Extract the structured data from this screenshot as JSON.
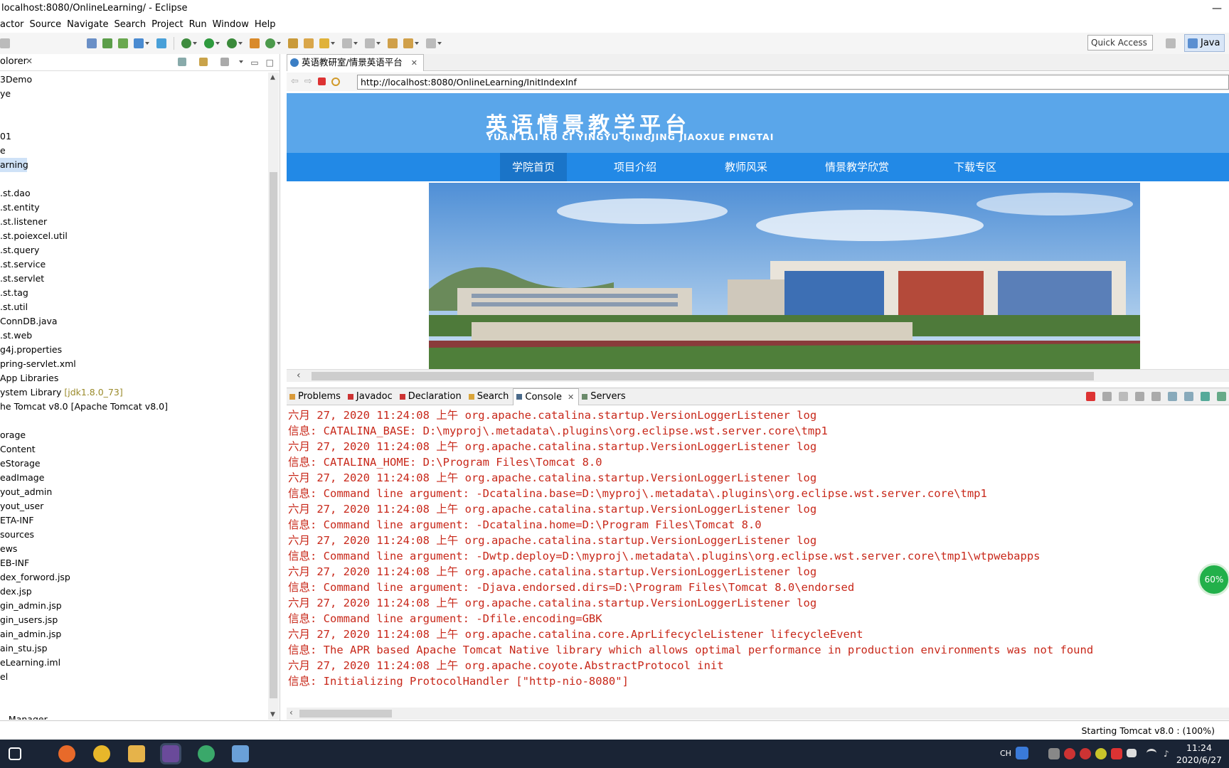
{
  "window": {
    "title": "localhost:8080/OnlineLearning/ - Eclipse"
  },
  "menu": [
    "actor",
    "Source",
    "Navigate",
    "Search",
    "Project",
    "Run",
    "Window",
    "Help"
  ],
  "toolbar": {
    "quick_access": "Quick Access",
    "perspective": "Java"
  },
  "explorer": {
    "tab_label": "olorer",
    "rows": [
      {
        "text": "3Demo"
      },
      {
        "text": "ye"
      },
      {
        "text": ""
      },
      {
        "text": ""
      },
      {
        "text": "01"
      },
      {
        "text": "e"
      },
      {
        "text": "arning",
        "selected": true
      },
      {
        "text": ""
      },
      {
        "text": ".st.dao"
      },
      {
        "text": ".st.entity"
      },
      {
        "text": ".st.listener"
      },
      {
        "text": ".st.poiexcel.util"
      },
      {
        "text": ".st.query"
      },
      {
        "text": ".st.service"
      },
      {
        "text": ".st.servlet"
      },
      {
        "text": ".st.tag"
      },
      {
        "text": ".st.util"
      },
      {
        "text": " ConnDB.java"
      },
      {
        "text": ".st.web"
      },
      {
        "text": "g4j.properties"
      },
      {
        "text": "pring-servlet.xml"
      },
      {
        "text": " App Libraries"
      },
      {
        "text": "ystem Library ",
        "suffix": "[jdk1.8.0_73]"
      },
      {
        "text": "he Tomcat v8.0 [Apache Tomcat v8.0]"
      },
      {
        "text": ""
      },
      {
        "text": "orage"
      },
      {
        "text": "Content"
      },
      {
        "text": "eStorage"
      },
      {
        "text": "eadImage"
      },
      {
        "text": "yout_admin"
      },
      {
        "text": "yout_user"
      },
      {
        "text": "ETA-INF"
      },
      {
        "text": "sources"
      },
      {
        "text": "ews"
      },
      {
        "text": "EB-INF"
      },
      {
        "text": "dex_forword.jsp"
      },
      {
        "text": "dex.jsp"
      },
      {
        "text": "gin_admin.jsp"
      },
      {
        "text": "gin_users.jsp"
      },
      {
        "text": "ain_admin.jsp"
      },
      {
        "text": "ain_stu.jsp"
      },
      {
        "text": "eLearning.iml"
      },
      {
        "text": "el"
      },
      {
        "text": ""
      },
      {
        "text": ""
      },
      {
        "text": "...Manager"
      }
    ]
  },
  "editor": {
    "tab_label": "英语教研室/情景英语平台",
    "url": "http://localhost:8080/OnlineLearning/InitIndexInf",
    "site": {
      "title": "英语情景教学平台",
      "subtitle": "YUAN  LAI  RU CI  YINGYU  QINGJING  JIAOXUE PINGTAI",
      "nav": [
        "学院首页",
        "项目介绍",
        "教师风采",
        "情景教学欣赏",
        "下载专区"
      ],
      "active_nav": "学院首页"
    }
  },
  "console": {
    "tabs": [
      "Problems",
      "Javadoc",
      "Declaration",
      "Search",
      "Console",
      "Servers"
    ],
    "active_tab": "Console",
    "lines": [
      "六月 27, 2020 11:24:08 上午 org.apache.catalina.startup.VersionLoggerListener log",
      "信息: CATALINA_BASE:         D:\\myproj\\.metadata\\.plugins\\org.eclipse.wst.server.core\\tmp1",
      "六月 27, 2020 11:24:08 上午 org.apache.catalina.startup.VersionLoggerListener log",
      "信息: CATALINA_HOME:         D:\\Program Files\\Tomcat 8.0",
      "六月 27, 2020 11:24:08 上午 org.apache.catalina.startup.VersionLoggerListener log",
      "信息: Command line argument: -Dcatalina.base=D:\\myproj\\.metadata\\.plugins\\org.eclipse.wst.server.core\\tmp1",
      "六月 27, 2020 11:24:08 上午 org.apache.catalina.startup.VersionLoggerListener log",
      "信息: Command line argument: -Dcatalina.home=D:\\Program Files\\Tomcat 8.0",
      "六月 27, 2020 11:24:08 上午 org.apache.catalina.startup.VersionLoggerListener log",
      "信息: Command line argument: -Dwtp.deploy=D:\\myproj\\.metadata\\.plugins\\org.eclipse.wst.server.core\\tmp1\\wtpwebapps",
      "六月 27, 2020 11:24:08 上午 org.apache.catalina.startup.VersionLoggerListener log",
      "信息: Command line argument: -Djava.endorsed.dirs=D:\\Program Files\\Tomcat 8.0\\endorsed",
      "六月 27, 2020 11:24:08 上午 org.apache.catalina.startup.VersionLoggerListener log",
      "信息: Command line argument: -Dfile.encoding=GBK",
      "六月 27, 2020 11:24:08 上午 org.apache.catalina.core.AprLifecycleListener lifecycleEvent",
      "信息: The APR based Apache Tomcat Native library which allows optimal performance in production environments was not found",
      "六月 27, 2020 11:24:08 上午 org.apache.coyote.AbstractProtocol init",
      "信息: Initializing ProtocolHandler [\"http-nio-8080\"]"
    ]
  },
  "badge": {
    "percent": "60%"
  },
  "status": {
    "message": "Starting Tomcat v8.0 : (100%)"
  },
  "taskbar": {
    "ime": "CH",
    "time": "11:24",
    "date": "2020/6/27"
  },
  "colors": {
    "site_header": "#5aa6ea",
    "site_nav": "#2289e6",
    "console_text": "#c8281a",
    "taskbar": "#1a2435"
  }
}
